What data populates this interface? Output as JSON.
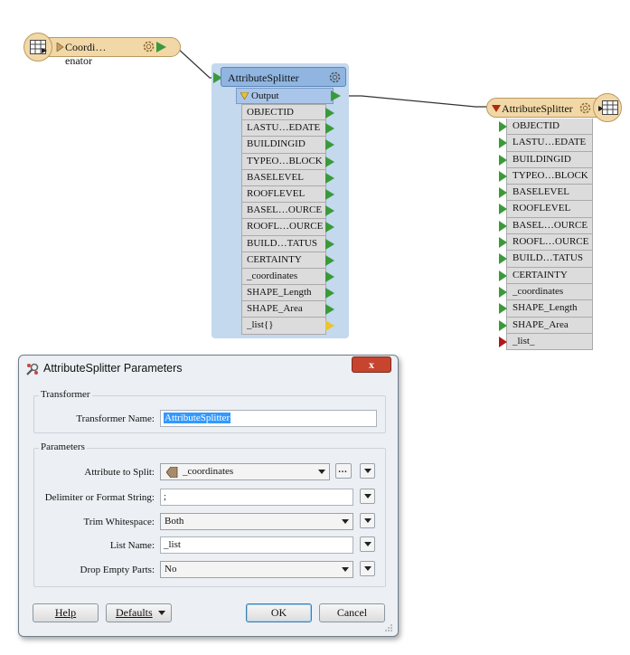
{
  "canvas": {
    "reader": {
      "label": "Coordi…enator",
      "icon": "table-reader-icon"
    },
    "splitter": {
      "title": "AttributeSplitter",
      "output_label": "Output",
      "ports": [
        "OBJECTID",
        "LASTU…EDATE",
        "BUILDINGID",
        "TYPEO…BLOCK",
        "BASELEVEL",
        "ROOFLEVEL",
        "BASEL…OURCE",
        "ROOFL…OURCE",
        "BUILD…TATUS",
        "CERTAINTY",
        "_coordinates",
        "SHAPE_Length",
        "SHAPE_Area",
        "_list{}"
      ]
    },
    "writer": {
      "title": "AttributeSplitter",
      "ports": [
        "OBJECTID",
        "LASTU…EDATE",
        "BUILDINGID",
        "TYPEO…BLOCK",
        "BASELEVEL",
        "ROOFLEVEL",
        "BASEL…OURCE",
        "ROOFL…OURCE",
        "BUILD…TATUS",
        "CERTAINTY",
        "_coordinates",
        "SHAPE_Length",
        "SHAPE_Area",
        "_list_"
      ]
    },
    "colors": {
      "port_green": "#3a9a3a",
      "port_yellow": "#e8c52e",
      "port_red": "#b01818"
    }
  },
  "dialog": {
    "title": "AttributeSplitter Parameters",
    "close_label": "x",
    "transformer_group": "Transformer",
    "transformer_name_label": "Transformer Name:",
    "transformer_name_value": "AttributeSplitter",
    "parameters_group": "Parameters",
    "attr_split_label": "Attribute to Split:",
    "attr_split_value": "_coordinates",
    "ellipsis_label": "…",
    "delimiter_label": "Delimiter or Format String:",
    "delimiter_value": ";",
    "trim_label": "Trim Whitespace:",
    "trim_value": "Both",
    "list_name_label": "List Name:",
    "list_name_value": "_list",
    "drop_empty_label": "Drop Empty Parts:",
    "drop_empty_value": "No",
    "help_label": "Help",
    "defaults_label": "Defaults",
    "ok_label": "OK",
    "cancel_label": "Cancel"
  }
}
